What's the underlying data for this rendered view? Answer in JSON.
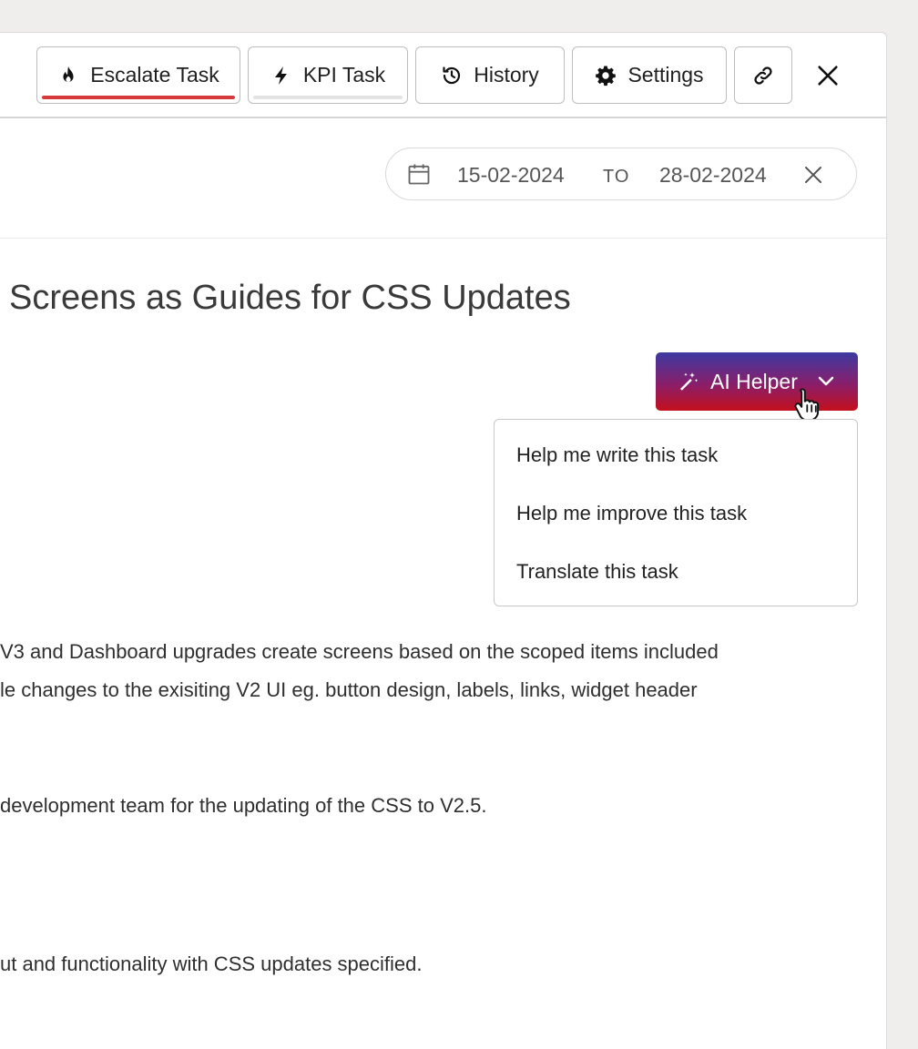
{
  "toolbar": {
    "escalate_label": "Escalate Task",
    "kpi_label": "KPI Task",
    "history_label": "History",
    "settings_label": "Settings"
  },
  "date_range": {
    "from": "15-02-2024",
    "separator": "TO",
    "to": "28-02-2024"
  },
  "task": {
    "title": "Screens as Guides for CSS Updates",
    "description_lines": [
      "V3 and Dashboard upgrades create screens based on the scoped items included",
      "le changes to the exisiting V2 UI eg. button design, labels, links, widget header",
      "development team for the updating of the CSS to V2.5.",
      "ut and functionality with CSS updates specified."
    ]
  },
  "ai_helper": {
    "label": "AI Helper",
    "menu": [
      "Help me write this task",
      "Help me improve this task",
      "Translate this task"
    ]
  },
  "colors": {
    "escalate_underline": "#d63b3b",
    "ai_gradient_top": "#3c3aa1",
    "ai_gradient_bottom": "#c4101c"
  }
}
